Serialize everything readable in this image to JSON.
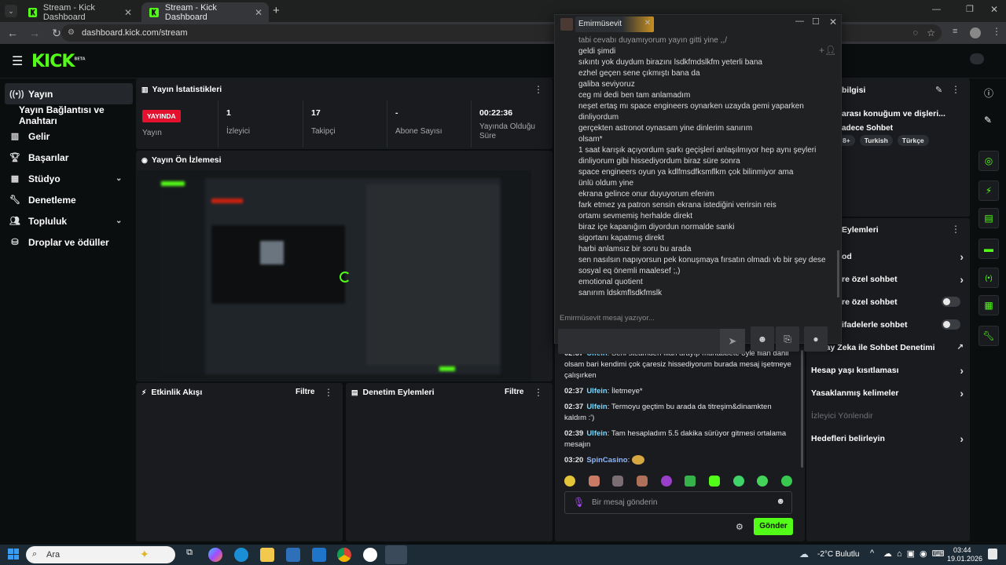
{
  "browser": {
    "tabs": [
      {
        "title": "Stream - Kick Dashboard"
      },
      {
        "title": "Stream - Kick Dashboard"
      }
    ],
    "url": "dashboard.kick.com/stream"
  },
  "kick": {
    "logo": "KICK",
    "logo_sup": "BETA"
  },
  "sidebar": {
    "items": [
      {
        "label": "Yayın",
        "icon": "broadcast-icon"
      },
      {
        "label": "Yayın Bağlantısı ve Anahtarı",
        "icon": ""
      },
      {
        "label": "Gelir",
        "icon": "chart-icon"
      },
      {
        "label": "Başarılar",
        "icon": "trophy-icon"
      },
      {
        "label": "Stüdyo",
        "icon": "studio-icon"
      },
      {
        "label": "Denetleme",
        "icon": "wrench-icon"
      },
      {
        "label": "Topluluk",
        "icon": "people-icon"
      },
      {
        "label": "Droplar ve ödüller",
        "icon": "gift-icon"
      }
    ]
  },
  "stats": {
    "title": "Yayın İstatistikleri",
    "live_badge": "YAYINDA",
    "live_label": "Yayın",
    "viewers": "1",
    "viewers_label": "İzleyici",
    "followers": "17",
    "followers_label": "Takipçi",
    "subs": "-",
    "subs_label": "Abone Sayısı",
    "duration": "00:22:36",
    "duration_label": "Yayında Olduğu Süre"
  },
  "preview": {
    "title": "Yayın Ön İzlemesi"
  },
  "activity": {
    "title": "Etkinlik Akışı",
    "filter": "Filtre"
  },
  "modactions": {
    "title": "Denetim Eylemleri",
    "filter": "Filtre"
  },
  "popup": {
    "name": "Emirmüsevit",
    "messages": [
      "tabi cevabı duyamıyorum yayın gitti yine ,,/",
      "geldi şimdi",
      "sıkıntı yok duydum birazını lsdkfmdslkfm yeterli bana",
      "ezhel geçen sene çıkmıştı bana da",
      "galiba seviyoruz",
      "ceg mi dedi ben tam anlamadım",
      "neşet ertaş mı space engineers oynarken uzayda gemi yaparken dinliyordum",
      "gerçekten astronot oynasam yine dinlerim sanırım",
      "olsam*",
      "1 saat karışık açıyordum şarkı geçişleri anlaşılmıyor hep aynı şeyleri dinliyorum gibi hissediyordum biraz süre sonra",
      "space engineers oyun ya kdlfmsdfksmflkm çok bilinmiyor ama",
      "ünlü oldum yine",
      "ekrana gelince onur duyuyorum efenim",
      "fark etmez ya patron sensin ekrana istediğini verirsin reis",
      "ortamı sevmemiş herhalde direkt",
      "biraz içe kapanığım diyordun normalde sanki",
      "sigortanı kapatmış direkt",
      "harbi anlamsız bir soru bu arada",
      "sen nasılsın napıyorsun pek konuşmaya fırsatın olmadı vb bir şey dese",
      "sosyal eq önemli maalesef ;,)",
      "emotional quotient",
      "sanırım ldskmflsdkfmslk"
    ],
    "typing": "Emirmüsevit mesaj yazıyor..."
  },
  "chat": {
    "messages": [
      {
        "time": "02:37",
        "user": "Ulfein",
        "text": "Seni steamden filan arayıp muhabbete öyle filan dahil olsam bari kendimi çok çaresiz hissediyorum burada mesaj işetmeye çalışırken"
      },
      {
        "time": "02:37",
        "user": "Ulfein",
        "text": "İletmeye*"
      },
      {
        "time": "02:37",
        "user": "Ulfein",
        "text": "Termoyu geçtim bu arada da titreşim&dinamkten kaldım :')"
      },
      {
        "time": "02:39",
        "user": "Ulfein",
        "text": "Tam hesapladım 5.5 dakika sürüyor gitmesi ortalama mesajın"
      },
      {
        "time": "03:20",
        "user": "SpinCasino",
        "text": ""
      }
    ],
    "placeholder": "Bir mesaj gönderin",
    "send": "Gönder"
  },
  "streaminfo": {
    "title": "bilgisi",
    "stream_title": "arası konuğum ve dişleri...",
    "category": "adece Sohbet",
    "tags": [
      "8+",
      "Turkish",
      "Türkçe"
    ]
  },
  "chatactions": {
    "title": "Eylemleri",
    "rows": [
      {
        "label": "od",
        "kind": "arrow"
      },
      {
        "label": "re özel sohbet",
        "kind": "arrow"
      },
      {
        "label": "re özel sohbet",
        "kind": "toggle"
      },
      {
        "label": "ifadelerle sohbet",
        "kind": "toggle"
      },
      {
        "label": "Yapay Zeka ile Sohbet Denetimi",
        "kind": "external"
      },
      {
        "label": "Hesap yaşı kısıtlaması",
        "kind": "arrow"
      },
      {
        "label": "Yasaklanmış kelimeler",
        "kind": "arrow"
      },
      {
        "label": "İzleyici Yönlendir",
        "kind": "disabled"
      },
      {
        "label": "Hedefleri belirleyin",
        "kind": "arrow"
      }
    ]
  },
  "taskbar": {
    "search": "Ara",
    "weather": "-2°C  Bulutlu",
    "time": "03:44",
    "date": "19.01.2026"
  }
}
